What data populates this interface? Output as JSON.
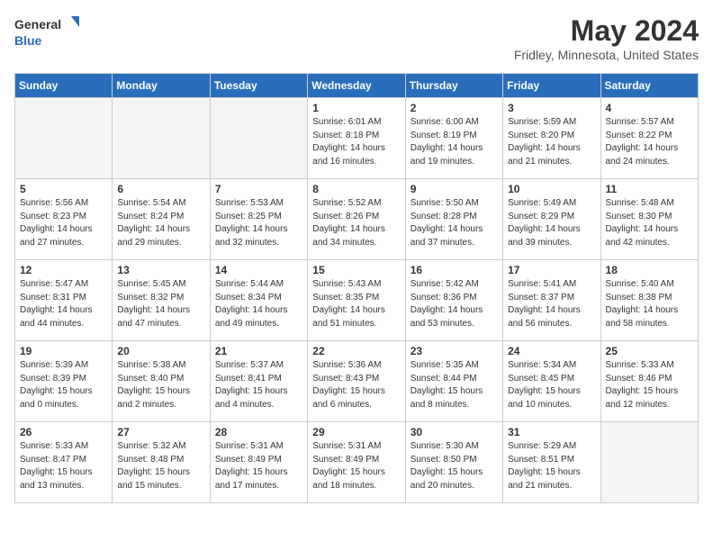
{
  "header": {
    "logo_general": "General",
    "logo_blue": "Blue",
    "month": "May 2024",
    "location": "Fridley, Minnesota, United States"
  },
  "days_of_week": [
    "Sunday",
    "Monday",
    "Tuesday",
    "Wednesday",
    "Thursday",
    "Friday",
    "Saturday"
  ],
  "weeks": [
    [
      {
        "day": "",
        "content": "",
        "empty": true
      },
      {
        "day": "",
        "content": "",
        "empty": true
      },
      {
        "day": "",
        "content": "",
        "empty": true
      },
      {
        "day": "1",
        "content": "Sunrise: 6:01 AM\nSunset: 8:18 PM\nDaylight: 14 hours\nand 16 minutes.",
        "empty": false
      },
      {
        "day": "2",
        "content": "Sunrise: 6:00 AM\nSunset: 8:19 PM\nDaylight: 14 hours\nand 19 minutes.",
        "empty": false
      },
      {
        "day": "3",
        "content": "Sunrise: 5:59 AM\nSunset: 8:20 PM\nDaylight: 14 hours\nand 21 minutes.",
        "empty": false
      },
      {
        "day": "4",
        "content": "Sunrise: 5:57 AM\nSunset: 8:22 PM\nDaylight: 14 hours\nand 24 minutes.",
        "empty": false
      }
    ],
    [
      {
        "day": "5",
        "content": "Sunrise: 5:56 AM\nSunset: 8:23 PM\nDaylight: 14 hours\nand 27 minutes.",
        "empty": false
      },
      {
        "day": "6",
        "content": "Sunrise: 5:54 AM\nSunset: 8:24 PM\nDaylight: 14 hours\nand 29 minutes.",
        "empty": false
      },
      {
        "day": "7",
        "content": "Sunrise: 5:53 AM\nSunset: 8:25 PM\nDaylight: 14 hours\nand 32 minutes.",
        "empty": false
      },
      {
        "day": "8",
        "content": "Sunrise: 5:52 AM\nSunset: 8:26 PM\nDaylight: 14 hours\nand 34 minutes.",
        "empty": false
      },
      {
        "day": "9",
        "content": "Sunrise: 5:50 AM\nSunset: 8:28 PM\nDaylight: 14 hours\nand 37 minutes.",
        "empty": false
      },
      {
        "day": "10",
        "content": "Sunrise: 5:49 AM\nSunset: 8:29 PM\nDaylight: 14 hours\nand 39 minutes.",
        "empty": false
      },
      {
        "day": "11",
        "content": "Sunrise: 5:48 AM\nSunset: 8:30 PM\nDaylight: 14 hours\nand 42 minutes.",
        "empty": false
      }
    ],
    [
      {
        "day": "12",
        "content": "Sunrise: 5:47 AM\nSunset: 8:31 PM\nDaylight: 14 hours\nand 44 minutes.",
        "empty": false
      },
      {
        "day": "13",
        "content": "Sunrise: 5:45 AM\nSunset: 8:32 PM\nDaylight: 14 hours\nand 47 minutes.",
        "empty": false
      },
      {
        "day": "14",
        "content": "Sunrise: 5:44 AM\nSunset: 8:34 PM\nDaylight: 14 hours\nand 49 minutes.",
        "empty": false
      },
      {
        "day": "15",
        "content": "Sunrise: 5:43 AM\nSunset: 8:35 PM\nDaylight: 14 hours\nand 51 minutes.",
        "empty": false
      },
      {
        "day": "16",
        "content": "Sunrise: 5:42 AM\nSunset: 8:36 PM\nDaylight: 14 hours\nand 53 minutes.",
        "empty": false
      },
      {
        "day": "17",
        "content": "Sunrise: 5:41 AM\nSunset: 8:37 PM\nDaylight: 14 hours\nand 56 minutes.",
        "empty": false
      },
      {
        "day": "18",
        "content": "Sunrise: 5:40 AM\nSunset: 8:38 PM\nDaylight: 14 hours\nand 58 minutes.",
        "empty": false
      }
    ],
    [
      {
        "day": "19",
        "content": "Sunrise: 5:39 AM\nSunset: 8:39 PM\nDaylight: 15 hours\nand 0 minutes.",
        "empty": false
      },
      {
        "day": "20",
        "content": "Sunrise: 5:38 AM\nSunset: 8:40 PM\nDaylight: 15 hours\nand 2 minutes.",
        "empty": false
      },
      {
        "day": "21",
        "content": "Sunrise: 5:37 AM\nSunset: 8:41 PM\nDaylight: 15 hours\nand 4 minutes.",
        "empty": false
      },
      {
        "day": "22",
        "content": "Sunrise: 5:36 AM\nSunset: 8:43 PM\nDaylight: 15 hours\nand 6 minutes.",
        "empty": false
      },
      {
        "day": "23",
        "content": "Sunrise: 5:35 AM\nSunset: 8:44 PM\nDaylight: 15 hours\nand 8 minutes.",
        "empty": false
      },
      {
        "day": "24",
        "content": "Sunrise: 5:34 AM\nSunset: 8:45 PM\nDaylight: 15 hours\nand 10 minutes.",
        "empty": false
      },
      {
        "day": "25",
        "content": "Sunrise: 5:33 AM\nSunset: 8:46 PM\nDaylight: 15 hours\nand 12 minutes.",
        "empty": false
      }
    ],
    [
      {
        "day": "26",
        "content": "Sunrise: 5:33 AM\nSunset: 8:47 PM\nDaylight: 15 hours\nand 13 minutes.",
        "empty": false
      },
      {
        "day": "27",
        "content": "Sunrise: 5:32 AM\nSunset: 8:48 PM\nDaylight: 15 hours\nand 15 minutes.",
        "empty": false
      },
      {
        "day": "28",
        "content": "Sunrise: 5:31 AM\nSunset: 8:49 PM\nDaylight: 15 hours\nand 17 minutes.",
        "empty": false
      },
      {
        "day": "29",
        "content": "Sunrise: 5:31 AM\nSunset: 8:49 PM\nDaylight: 15 hours\nand 18 minutes.",
        "empty": false
      },
      {
        "day": "30",
        "content": "Sunrise: 5:30 AM\nSunset: 8:50 PM\nDaylight: 15 hours\nand 20 minutes.",
        "empty": false
      },
      {
        "day": "31",
        "content": "Sunrise: 5:29 AM\nSunset: 8:51 PM\nDaylight: 15 hours\nand 21 minutes.",
        "empty": false
      },
      {
        "day": "",
        "content": "",
        "empty": true
      }
    ]
  ]
}
